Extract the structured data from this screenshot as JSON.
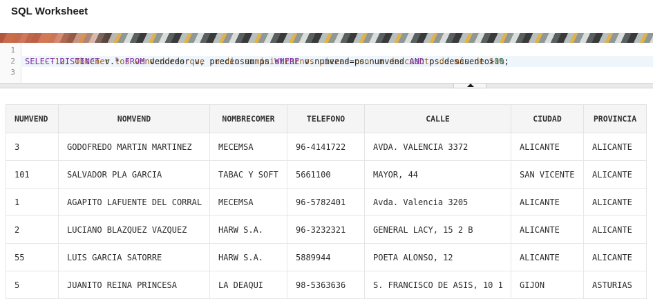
{
  "header": {
    "title": "SQL Worksheet"
  },
  "editor": {
    "line_numbers": [
      "1",
      "2",
      "3"
    ],
    "line1": {
      "comment": "--12. Obtener los vendedores que pueden suministrarnos piezas con un descuento de más de 10%."
    },
    "line2": {
      "kw_select": "SELECT",
      "kw_distinct": "DISTINCT",
      "t1": " v.* ",
      "kw_from": "FROM",
      "t2": " vendedor v, preciosum ps ",
      "kw_where": "WHERE",
      "t3": " v.numvend=ps.numvend ",
      "kw_and": "AND",
      "t4": " ps.descuento>",
      "num": "10",
      "t5": ";"
    }
  },
  "results": {
    "columns": [
      "NUMVEND",
      "NOMVEND",
      "NOMBRECOMER",
      "TELEFONO",
      "CALLE",
      "CIUDAD",
      "PROVINCIA"
    ],
    "rows": [
      [
        "3",
        "GODOFREDO MARTIN MARTINEZ",
        "MECEMSA",
        "96-4141722",
        "AVDA. VALENCIA 3372",
        "ALICANTE",
        "ALICANTE"
      ],
      [
        "101",
        "SALVADOR PLA GARCIA",
        "TABAC Y SOFT",
        "5661100",
        "MAYOR, 44",
        "SAN VICENTE",
        "ALICANTE"
      ],
      [
        "1",
        "AGAPITO LAFUENTE DEL CORRAL",
        "MECEMSA",
        "96-5782401",
        "Avda. Valencia 3205",
        "ALICANTE",
        "ALICANTE"
      ],
      [
        "2",
        "LUCIANO BLAZQUEZ VAZQUEZ",
        "HARW S.A.",
        "96-3232321",
        "GENERAL LACY, 15 2 B",
        "ALICANTE",
        "ALICANTE"
      ],
      [
        "55",
        "LUIS GARCIA SATORRE",
        "HARW S.A.",
        "5889944",
        "POETA ALONSO, 12",
        "ALICANTE",
        "ALICANTE"
      ],
      [
        "5",
        "JUANITO REINA PRINCESA",
        "LA DEAQUI",
        "98-5363636",
        "S. FRANCISCO DE ASIS, 10 1",
        "GIJON",
        "ASTURIAS"
      ]
    ]
  },
  "icons": {
    "splitter": "caret-up-icon"
  }
}
